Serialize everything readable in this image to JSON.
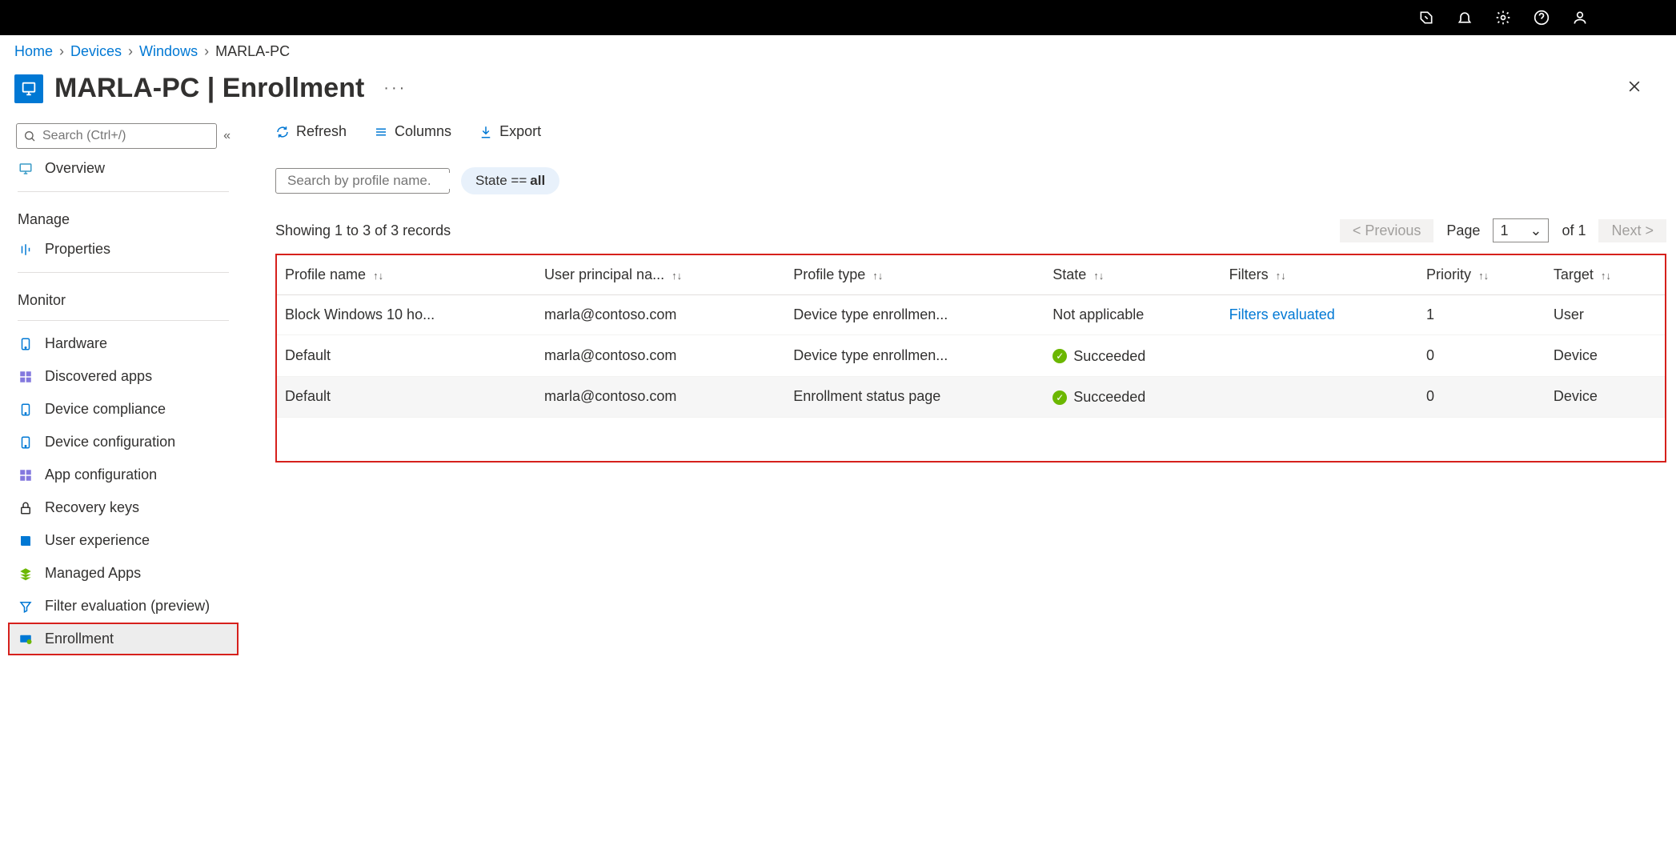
{
  "breadcrumb": [
    "Home",
    "Devices",
    "Windows",
    "MARLA-PC"
  ],
  "page_title": "MARLA-PC | Enrollment",
  "sidebar": {
    "search_placeholder": "Search (Ctrl+/)",
    "items": [
      {
        "kind": "item",
        "label": "Overview",
        "icon": "monitor",
        "group": null
      },
      {
        "kind": "section",
        "label": "Manage"
      },
      {
        "kind": "item",
        "label": "Properties",
        "icon": "properties"
      },
      {
        "kind": "section",
        "label": "Monitor"
      },
      {
        "kind": "item",
        "label": "Hardware",
        "icon": "device"
      },
      {
        "kind": "item",
        "label": "Discovered apps",
        "icon": "apps"
      },
      {
        "kind": "item",
        "label": "Device compliance",
        "icon": "device"
      },
      {
        "kind": "item",
        "label": "Device configuration",
        "icon": "device"
      },
      {
        "kind": "item",
        "label": "App configuration",
        "icon": "apps"
      },
      {
        "kind": "item",
        "label": "Recovery keys",
        "icon": "lock"
      },
      {
        "kind": "item",
        "label": "User experience",
        "icon": "book"
      },
      {
        "kind": "item",
        "label": "Managed Apps",
        "icon": "stack"
      },
      {
        "kind": "item",
        "label": "Filter evaluation (preview)",
        "icon": "filter"
      },
      {
        "kind": "item",
        "label": "Enrollment",
        "icon": "enroll",
        "active": true,
        "highlighted": true
      }
    ]
  },
  "toolbar": {
    "refresh": "Refresh",
    "columns": "Columns",
    "export": "Export"
  },
  "profile_search_placeholder": "Search by profile name.",
  "state_pill_prefix": "State == ",
  "state_pill_value": "all",
  "records_text": "Showing 1 to 3 of 3 records",
  "pagination": {
    "previous": "<  Previous",
    "next": "Next  >",
    "page_label": "Page",
    "page_value": "1",
    "page_total": "of 1"
  },
  "columns": [
    "Profile name",
    "User principal na...",
    "Profile type",
    "State",
    "Filters",
    "Priority",
    "Target"
  ],
  "rows": [
    {
      "profile": "Block Windows 10 ho...",
      "upn": "marla@contoso.com",
      "type": "Device type enrollmen...",
      "state": "Not applicable",
      "state_ok": false,
      "filters": "Filters evaluated",
      "filters_link": true,
      "priority": "1",
      "target": "User"
    },
    {
      "profile": "Default",
      "upn": "marla@contoso.com",
      "type": "Device type enrollmen...",
      "state": "Succeeded",
      "state_ok": true,
      "filters": "",
      "filters_link": false,
      "priority": "0",
      "target": "Device"
    },
    {
      "profile": "Default",
      "upn": "marla@contoso.com",
      "type": "Enrollment status page",
      "state": "Succeeded",
      "state_ok": true,
      "filters": "",
      "filters_link": false,
      "priority": "0",
      "target": "Device"
    }
  ]
}
